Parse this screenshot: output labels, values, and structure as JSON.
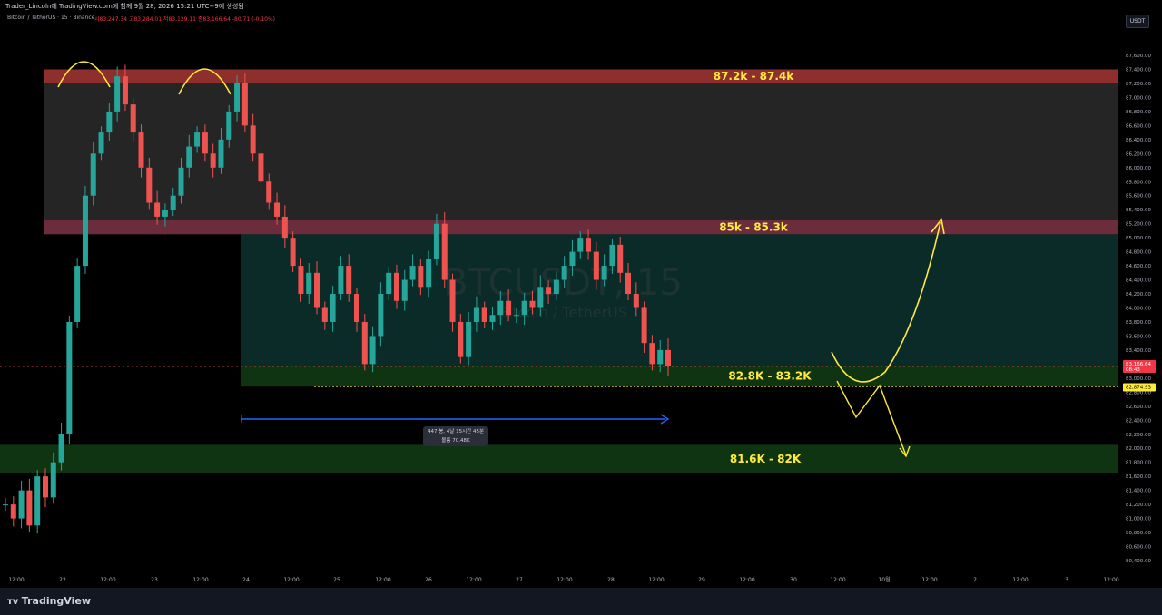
{
  "header": {
    "publish_text": "Trader_Lincoln에 TradingView.com에 함께 9월 28, 2026 15:21 UTC+9에 생성됨",
    "symbol": "Bitcoin / TetherUS · 15 · Binance",
    "ohlc": "시83,247.34  고83,284.01  저83,129.11  종83,166.64  -80.71 (-0.10%)"
  },
  "currency_button": "USDT",
  "watermark": {
    "ticker": "BTCUSDT, 15",
    "description": "Bitcoin / TetherUS"
  },
  "brand": "TradingView",
  "measure": {
    "line1": "447 봉, 4날 15시간 45분",
    "line2": "볼륨 70.48K"
  },
  "price_badges": {
    "last": "83,166.64",
    "countdown": "08:43",
    "dashed": "82,874.93"
  },
  "chart_data": {
    "type": "line",
    "title": "BTCUSDT, 15",
    "xlabel": "",
    "ylabel": "",
    "ylim": [
      80300,
      87800
    ],
    "price_ticks": [
      87600,
      87400,
      87200,
      87000,
      86800,
      86600,
      86400,
      86200,
      86000,
      85800,
      85600,
      85400,
      85200,
      85000,
      84800,
      84600,
      84400,
      84200,
      84000,
      83800,
      83600,
      83400,
      83200,
      83000,
      82800,
      82600,
      82400,
      82200,
      82000,
      81800,
      81600,
      81400,
      81200,
      81000,
      80800,
      80600,
      80400
    ],
    "time_labels": [
      "12:00",
      "22",
      "12:00",
      "23",
      "12:00",
      "24",
      "12:00",
      "25",
      "12:00",
      "26",
      "12:00",
      "27",
      "12:00",
      "28",
      "12:00",
      "29",
      "12:00",
      "30",
      "12:00",
      "10월",
      "12:00",
      "2",
      "12:00",
      "3",
      "12:00"
    ],
    "series": [
      {
        "values": [
          81200,
          81000,
          81400,
          80900,
          81600,
          81300,
          81800,
          82200,
          83800,
          84600,
          85600,
          86200,
          86500,
          86800,
          87300,
          86900,
          86500,
          86000,
          85500,
          85300,
          85400,
          85600,
          86000,
          86300,
          86500,
          86200,
          86000,
          86400,
          86800,
          87200,
          86600,
          86200,
          85800,
          85500,
          85300,
          85000,
          84600,
          84200,
          84500,
          84000,
          83800,
          84200,
          84600,
          84200,
          83800,
          83200,
          83600,
          84200,
          84500,
          84100,
          84400,
          84600,
          84300,
          84700,
          85200,
          84400,
          83800,
          83300,
          83800,
          84000,
          83800,
          83900,
          84100,
          83900,
          83900,
          84100,
          84000,
          84300,
          84200,
          84400,
          84600,
          84800,
          85000,
          84800,
          84400,
          84600,
          84900,
          84500,
          84200,
          84000,
          83500,
          83200,
          83400,
          83166
        ]
      }
    ],
    "zones": [
      {
        "label": "87.2k - 87.4k",
        "from": 87200,
        "to": 87400,
        "color": "#e53935"
      },
      {
        "label": "85k - 85.3k",
        "from": 85050,
        "to": 85250,
        "color": "#c2506e"
      },
      {
        "label": "82.8K - 83.2K",
        "from": 82880,
        "to": 83180,
        "color": "#1b5e20"
      },
      {
        "label": "81.6K - 82K",
        "from": 81650,
        "to": 82050,
        "color": "#1b5e20"
      }
    ],
    "colors": {
      "up": "#26a69a",
      "down": "#ef5350",
      "annotation": "#ffeb3b",
      "measure": "#2962ff"
    }
  }
}
